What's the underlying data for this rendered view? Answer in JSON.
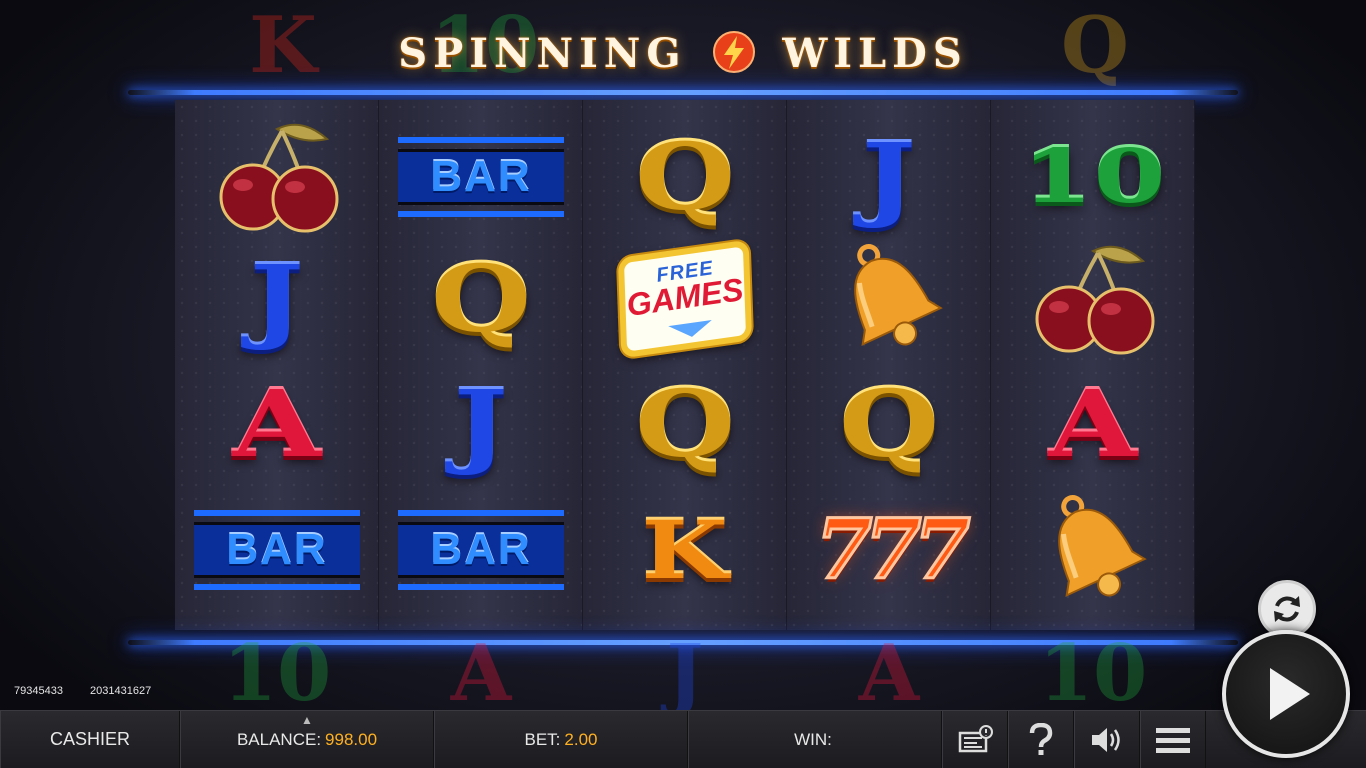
{
  "game": {
    "title_left": "SPINNING",
    "title_right": "WILDS"
  },
  "ghost_top": [
    "K",
    "10",
    "Q"
  ],
  "ghost_bottom": [
    "10",
    "A",
    "J",
    "A",
    "10"
  ],
  "reels": [
    [
      "cherry",
      "J",
      "A",
      "BAR"
    ],
    [
      "BAR",
      "Q",
      "J",
      "BAR"
    ],
    [
      "Q",
      "free-games",
      "Q",
      "K"
    ],
    [
      "J",
      "bell",
      "Q",
      "777"
    ],
    [
      "10",
      "cherry",
      "A",
      "bell"
    ]
  ],
  "symbol_text": {
    "bar": "BAR",
    "free_line1": "FREE",
    "free_line2": "GAMES",
    "sevens": "777"
  },
  "session": {
    "id_1": "79345433",
    "id_2": "2031431627"
  },
  "bottom_bar": {
    "cashier": "CASHIER",
    "balance_label": "BALANCE:",
    "balance_value": "998.00",
    "bet_label": "BET:",
    "bet_value": "2.00",
    "win_label": "WIN:",
    "win_value": ""
  },
  "icons": {
    "paytable": "paytable-icon",
    "help": "help-icon",
    "sound": "speaker-icon",
    "menu": "menu-icon",
    "autoplay": "autoplay-icon",
    "spin": "play-icon"
  },
  "colors": {
    "accent": "#ffb020",
    "neon": "#3e7bff"
  }
}
